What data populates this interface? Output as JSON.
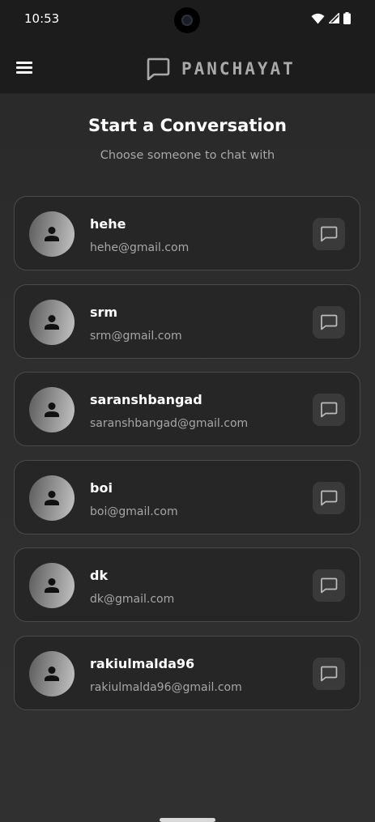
{
  "status_bar": {
    "time": "10:53"
  },
  "app_bar": {
    "title": "PANCHAYAT",
    "logo_icon": "chat-bubble-icon",
    "menu_icon": "hamburger-menu-icon"
  },
  "header": {
    "title": "Start a Conversation",
    "subtitle": "Choose someone to chat with"
  },
  "contacts": [
    {
      "name": "hehe",
      "email": "hehe@gmail.com"
    },
    {
      "name": "srm",
      "email": "srm@gmail.com"
    },
    {
      "name": "saranshbangad",
      "email": "saranshbangad@gmail.com"
    },
    {
      "name": "boi",
      "email": "boi@gmail.com"
    },
    {
      "name": "dk",
      "email": "dk@gmail.com"
    },
    {
      "name": "rakiulmalda96",
      "email": "rakiulmalda96@gmail.com"
    }
  ],
  "colors": {
    "background": "#2b2b2b",
    "card": "#262626",
    "card_border": "#4a4a4a",
    "muted_text": "#a6a6a6",
    "logo_text": "#a9a9a9"
  }
}
